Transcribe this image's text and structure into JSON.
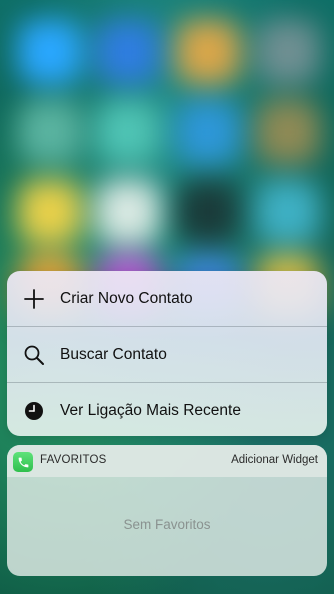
{
  "quick_actions": [
    {
      "label": "Criar Novo Contato",
      "icon": "plus-icon"
    },
    {
      "label": "Buscar Contato",
      "icon": "search-icon"
    },
    {
      "label": "Ver Ligação Mais Recente",
      "icon": "clock-icon"
    }
  ],
  "widget": {
    "app_icon": "phone-icon",
    "title": "FAVORITOS",
    "action_label": "Adicionar Widget",
    "empty_text": "Sem Favoritos"
  },
  "colors": {
    "widget_app_green": "#34c759",
    "text_primary": "#111111",
    "text_secondary": "#8a9290"
  }
}
